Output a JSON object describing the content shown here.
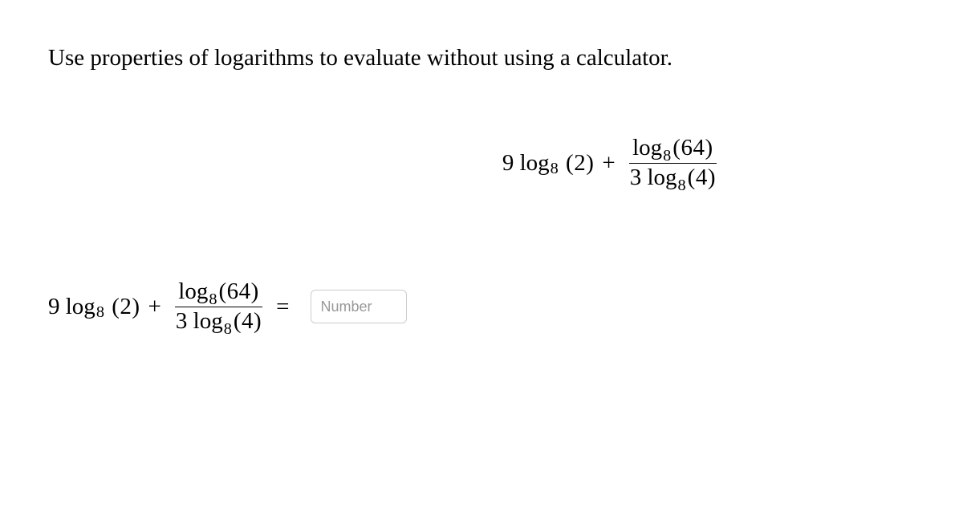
{
  "instruction": "Use properties of logarithms to evaluate without using a calculator.",
  "expr": {
    "coef1": "9",
    "log_word": "log",
    "base": "8",
    "arg1": "(2)",
    "plus": "+",
    "frac_num_arg": "(64)",
    "frac_den_coef": "3",
    "frac_den_arg": "(4)",
    "equals": "="
  },
  "input": {
    "placeholder": "Number"
  }
}
